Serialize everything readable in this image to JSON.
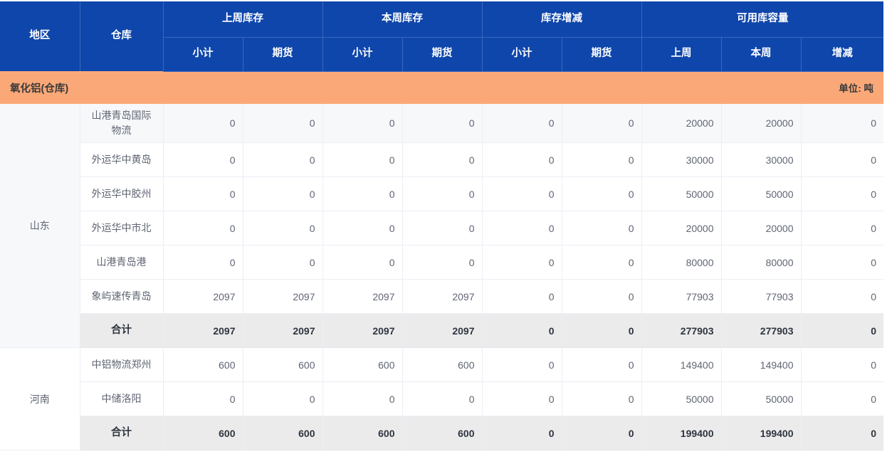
{
  "header": {
    "col_region": "地区",
    "col_warehouse": "仓库",
    "groups": [
      {
        "label": "上周库存",
        "subs": [
          "小计",
          "期货"
        ]
      },
      {
        "label": "本周库存",
        "subs": [
          "小计",
          "期货"
        ]
      },
      {
        "label": "库存增减",
        "subs": [
          "小计",
          "期货"
        ]
      },
      {
        "label": "可用库容量",
        "subs": [
          "上周",
          "本周",
          "增减"
        ]
      }
    ]
  },
  "banner": {
    "title": "氧化铝(仓库)",
    "unit": "单位: 吨"
  },
  "colors": {
    "header_blue": "#0f46ab",
    "banner_orange": "#fba878",
    "total_row_gray": "#ebebeb",
    "alt_row": "#f7f8fa",
    "border": "#ebeef5",
    "text": "#5f6573"
  },
  "groups": [
    {
      "region": "山东",
      "rows": [
        {
          "warehouse": "山港青岛国际物流",
          "values": [
            "0",
            "0",
            "0",
            "0",
            "0",
            "0",
            "20000",
            "20000",
            "0"
          ]
        },
        {
          "warehouse": "外运华中黄岛",
          "values": [
            "0",
            "0",
            "0",
            "0",
            "0",
            "0",
            "30000",
            "30000",
            "0"
          ]
        },
        {
          "warehouse": "外运华中胶州",
          "values": [
            "0",
            "0",
            "0",
            "0",
            "0",
            "0",
            "50000",
            "50000",
            "0"
          ]
        },
        {
          "warehouse": "外运华中市北",
          "values": [
            "0",
            "0",
            "0",
            "0",
            "0",
            "0",
            "20000",
            "20000",
            "0"
          ]
        },
        {
          "warehouse": "山港青岛港",
          "values": [
            "0",
            "0",
            "0",
            "0",
            "0",
            "0",
            "80000",
            "80000",
            "0"
          ]
        },
        {
          "warehouse": "象屿速传青岛",
          "values": [
            "2097",
            "2097",
            "2097",
            "2097",
            "0",
            "0",
            "77903",
            "77903",
            "0"
          ]
        }
      ],
      "total": {
        "label": "合计",
        "values": [
          "2097",
          "2097",
          "2097",
          "2097",
          "0",
          "0",
          "277903",
          "277903",
          "0"
        ]
      }
    },
    {
      "region": "河南",
      "rows": [
        {
          "warehouse": "中铝物流郑州",
          "values": [
            "600",
            "600",
            "600",
            "600",
            "0",
            "0",
            "149400",
            "149400",
            "0"
          ]
        },
        {
          "warehouse": "中储洛阳",
          "values": [
            "0",
            "0",
            "0",
            "0",
            "0",
            "0",
            "50000",
            "50000",
            "0"
          ]
        }
      ],
      "total": {
        "label": "合计",
        "values": [
          "600",
          "600",
          "600",
          "600",
          "0",
          "0",
          "199400",
          "199400",
          "0"
        ]
      }
    }
  ]
}
